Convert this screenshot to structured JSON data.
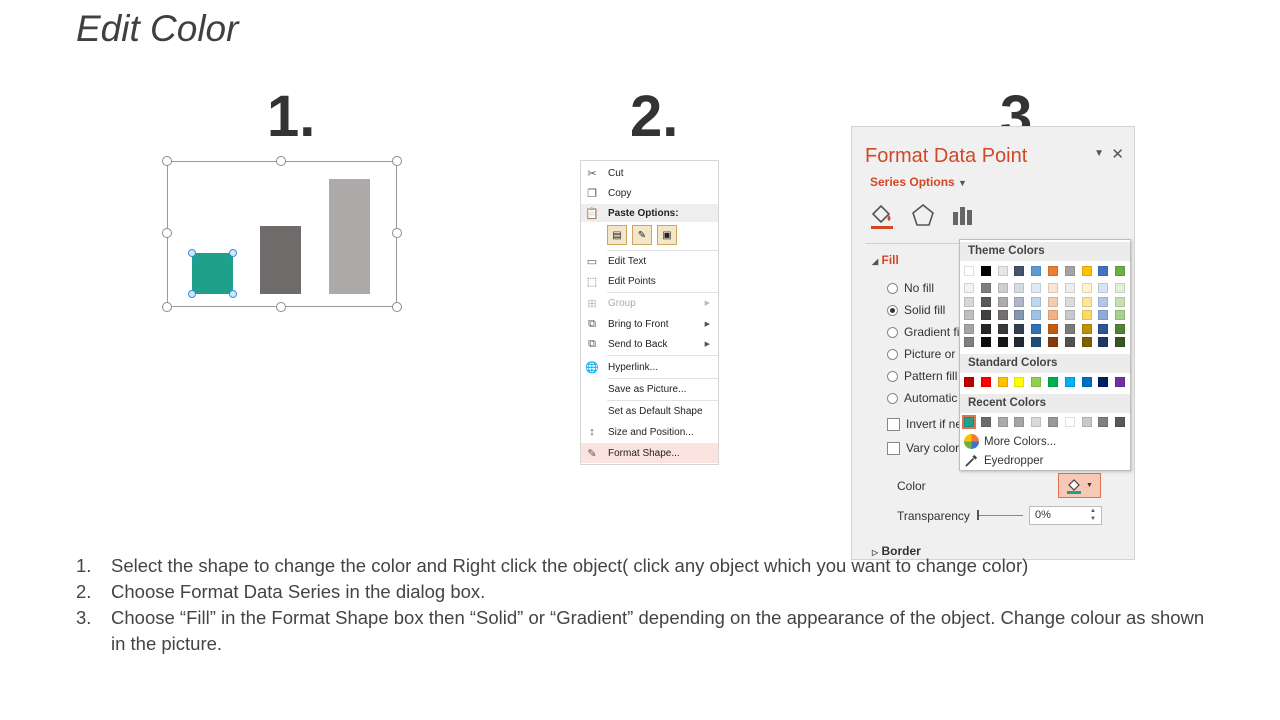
{
  "title": "Edit Color",
  "step_numbers": [
    "1.",
    "2.",
    "3."
  ],
  "colors": {
    "bar_teal": "#1ea08a",
    "bar_dark": "#6f6b6a",
    "bar_light": "#aeaaa9",
    "pane_accent": "#d24726",
    "menu_highlight": "#fbe3df"
  },
  "context_menu": {
    "items": [
      {
        "label": "Cut",
        "icon": "scissors-icon"
      },
      {
        "label": "Copy",
        "icon": "copy-icon"
      },
      {
        "label": "Paste Options:",
        "icon": "paste-icon"
      },
      {
        "label": "Edit Text",
        "icon": "edit-text-icon"
      },
      {
        "label": "Edit Points",
        "icon": "edit-points-icon"
      },
      {
        "label": "Group",
        "icon": "group-icon"
      },
      {
        "label": "Bring to Front",
        "icon": "bring-front-icon"
      },
      {
        "label": "Send to Back",
        "icon": "send-back-icon"
      },
      {
        "label": "Hyperlink...",
        "icon": "hyperlink-icon"
      },
      {
        "label": "Save as Picture...",
        "icon": ""
      },
      {
        "label": "Set as Default Shape",
        "icon": ""
      },
      {
        "label": "Size and Position...",
        "icon": "size-position-icon"
      },
      {
        "label": "Format Shape...",
        "icon": "format-shape-icon"
      }
    ]
  },
  "format_pane": {
    "title": "Format Data Point",
    "series_options": "Series Options",
    "fill_section": "Fill",
    "options": [
      "No fill",
      "Solid fill",
      "Gradient fi",
      "Picture or",
      "Pattern fill",
      "Automatic"
    ],
    "checks": [
      "Invert if ne",
      "Vary colors"
    ],
    "color_label": "Color",
    "transparency_label": "Transparency",
    "transparency_value": "0%",
    "border_section": "Border"
  },
  "picker": {
    "theme_header": "Theme Colors",
    "standard_header": "Standard Colors",
    "recent_header": "Recent Colors",
    "more_colors": "More Colors...",
    "eyedropper": "Eyedropper",
    "theme_top": [
      "#ffffff",
      "#000000",
      "#e7e6e6",
      "#44546a",
      "#5b9bd5",
      "#ed7d31",
      "#a5a5a5",
      "#ffc000",
      "#4472c4",
      "#70ad47"
    ],
    "theme_shades": [
      [
        "#f2f2f2",
        "#7f7f7f",
        "#d0cece",
        "#d6dce4",
        "#deebf6",
        "#fbe5d5",
        "#ededed",
        "#fff2cc",
        "#dae3f3",
        "#e2efd9"
      ],
      [
        "#d8d8d8",
        "#595959",
        "#aeabab",
        "#adb9ca",
        "#bdd7ee",
        "#f7cbac",
        "#dbdbdb",
        "#fee599",
        "#b4c6e7",
        "#c5e0b3"
      ],
      [
        "#bfbfbf",
        "#3f3f3f",
        "#757070",
        "#8496b0",
        "#9cc3e5",
        "#f4b183",
        "#c9c9c9",
        "#ffd965",
        "#8eaadb",
        "#a8d08d"
      ],
      [
        "#a5a5a5",
        "#262626",
        "#3a3838",
        "#323f4f",
        "#2e75b5",
        "#c55a11",
        "#7b7b7b",
        "#bf9000",
        "#2f5496",
        "#538135"
      ],
      [
        "#7f7f7f",
        "#0c0c0c",
        "#171616",
        "#222a35",
        "#1e4e79",
        "#833c0b",
        "#525252",
        "#7f6000",
        "#1f3864",
        "#375623"
      ]
    ],
    "standard": [
      "#c00000",
      "#ff0000",
      "#ffc000",
      "#ffff00",
      "#92d050",
      "#00b050",
      "#00b0f0",
      "#0070c0",
      "#002060",
      "#7030a0"
    ],
    "recent": [
      "#1ea08a",
      "#6f6b6a",
      "#aeaaa9",
      "#a6a6a6",
      "#d9d9d9",
      "#999999",
      "#ffffff",
      "#c9c9c9",
      "#7f7f7f",
      "#595959"
    ]
  },
  "instructions": [
    {
      "num": "1.",
      "text": "Select the shape to change the color and Right click the object( click any object which you want to change color)"
    },
    {
      "num": "2.",
      "text": "Choose Format Data Series in the dialog box."
    },
    {
      "num": "3.",
      "text": "Choose “Fill” in the Format Shape box then “Solid” or “Gradient” depending  on the appearance of the object. Change colour as shown in the picture."
    }
  ]
}
